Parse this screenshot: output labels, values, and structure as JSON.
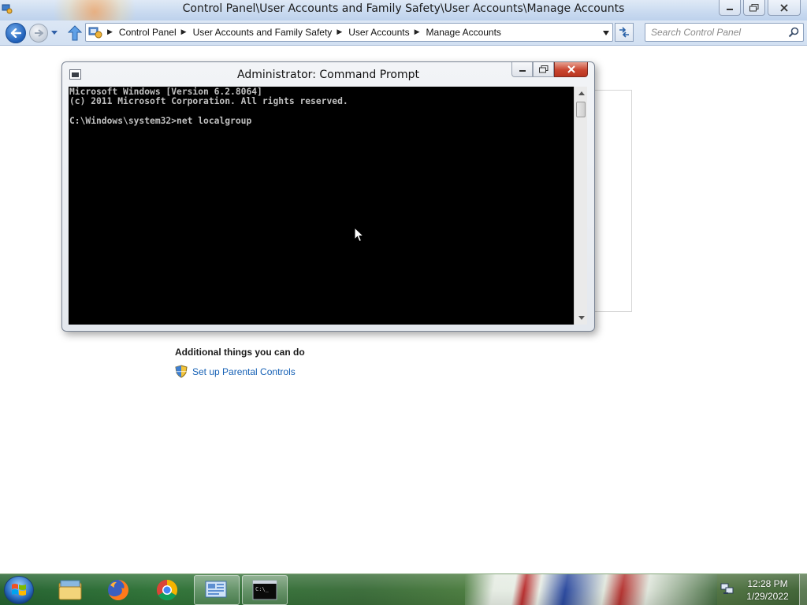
{
  "explorer": {
    "title": "Control Panel\\User Accounts and Family Safety\\User Accounts\\Manage Accounts",
    "breadcrumbs": [
      "Control Panel",
      "User Accounts and Family Safety",
      "User Accounts",
      "Manage Accounts"
    ],
    "search_placeholder": "Search Control Panel"
  },
  "content": {
    "additional_heading": "Additional things you can do",
    "parental_link": "Set up Parental Controls"
  },
  "cmd": {
    "title": "Administrator: Command Prompt",
    "console_lines": [
      "Microsoft Windows [Version 6.2.8064]",
      "(c) 2011 Microsoft Corporation. All rights reserved.",
      "",
      "C:\\Windows\\system32>net localgroup"
    ]
  },
  "taskbar": {
    "items": [
      "windows-explorer",
      "firefox",
      "chrome",
      "control-panel",
      "command-prompt"
    ],
    "active_items": [
      "control-panel",
      "command-prompt"
    ],
    "cmd_thumb_text": "C:\\_",
    "clock_time": "12:28 PM",
    "clock_date": "1/29/2022"
  },
  "colors": {
    "link": "#1560b5",
    "console_bg": "#000000",
    "console_text": "#c0c0c0",
    "close_button": "#c9452f"
  }
}
